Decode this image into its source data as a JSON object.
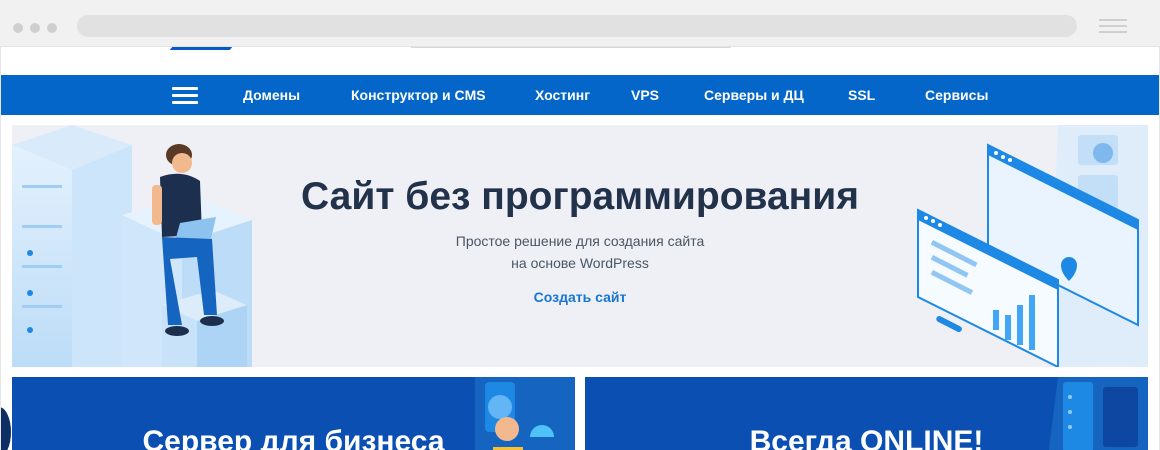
{
  "nav": {
    "items": [
      {
        "label": "Домены"
      },
      {
        "label": "Конструктор и CMS"
      },
      {
        "label": "Хостинг"
      },
      {
        "label": "VPS"
      },
      {
        "label": "Серверы и ДЦ"
      },
      {
        "label": "SSL"
      },
      {
        "label": "Сервисы"
      }
    ]
  },
  "hero": {
    "title": "Сайт без программирования",
    "subtitle_line1": "Простое решение для создания сайта",
    "subtitle_line2": "на основе WordPress",
    "cta": "Создать сайт"
  },
  "cards": [
    {
      "title": "Сервер для бизнеса"
    },
    {
      "title": "Всегда ONLINE!"
    }
  ],
  "icons": [
    "hamburger-menu-icon",
    "browser-menu-icon"
  ],
  "colors": {
    "nav": "#0366c8",
    "hero_bg": "#eef0f5",
    "card": "#0a4fb1",
    "link": "#1876d2",
    "title": "#22324a"
  }
}
